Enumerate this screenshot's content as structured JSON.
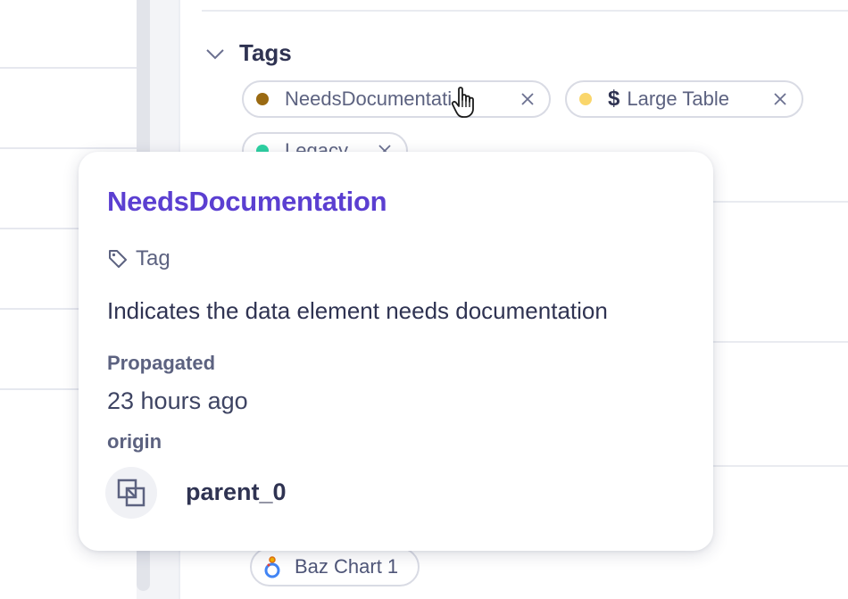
{
  "section": {
    "title": "Tags"
  },
  "tags": [
    {
      "label": "NeedsDocumentation",
      "display": "NeedsDocumentati...",
      "color": "#9a6a12"
    },
    {
      "label": "Large Table",
      "color": "#fad66b"
    },
    {
      "label": "Legacy",
      "color": "#2ed3a3"
    }
  ],
  "related": {
    "label": "Baz Chart 1"
  },
  "popover": {
    "title": "NeedsDocumentation",
    "type_label": "Tag",
    "description": "Indicates the data element needs documentation",
    "propagated_label": "Propagated",
    "propagated_time": "23 hours ago",
    "origin_label": "origin",
    "origin_name": "parent_0"
  },
  "colors": {
    "accent": "#5b3fd1",
    "text": "#2f3352",
    "muted": "#5c6280",
    "border": "#d9dbe4"
  },
  "icons": [
    "chevron-down-icon",
    "close-icon",
    "dollar-icon",
    "hand-pointer-icon",
    "chart-logo-icon",
    "tag-icon",
    "dataset-icon"
  ]
}
